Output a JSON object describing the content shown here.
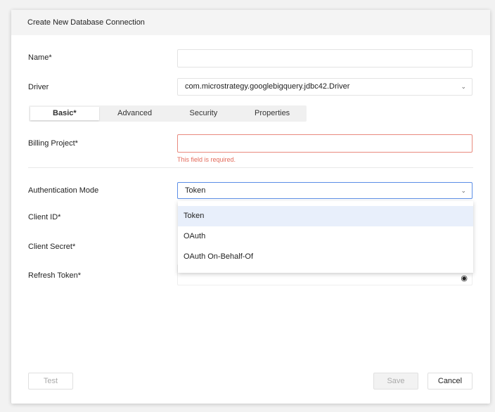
{
  "dialog": {
    "title": "Create New Database Connection"
  },
  "form": {
    "name_label": "Name*",
    "name_value": "",
    "driver_label": "Driver",
    "driver_value": "com.microstrategy.googlebigquery.jdbc42.Driver",
    "tabs": [
      {
        "label": "Basic*",
        "active": true
      },
      {
        "label": "Advanced"
      },
      {
        "label": "Security"
      },
      {
        "label": "Properties"
      }
    ],
    "billing_label": "Billing Project*",
    "billing_value": "",
    "billing_error": "This field is required.",
    "auth_label": "Authentication Mode",
    "auth_value": "Token",
    "auth_options": [
      "Token",
      "OAuth",
      "OAuth On-Behalf-Of"
    ],
    "client_id_label": "Client ID*",
    "client_secret_label": "Client Secret*",
    "refresh_token_label": "Refresh Token*"
  },
  "buttons": {
    "test": "Test",
    "save": "Save",
    "cancel": "Cancel"
  },
  "colors": {
    "error": "#e36a5a",
    "focus": "#5b8ee6",
    "highlight": "#e8effb"
  }
}
